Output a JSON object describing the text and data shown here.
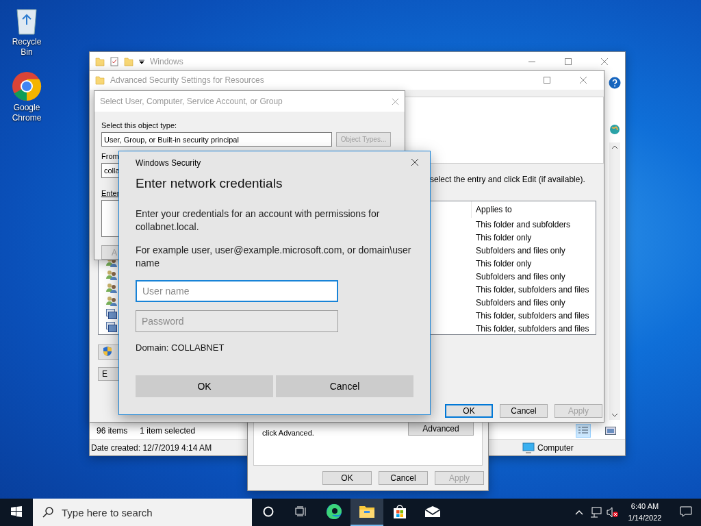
{
  "desktop_icons": [
    {
      "kind": "recycle",
      "label": "Recycle Bin"
    },
    {
      "kind": "chrome",
      "label": "Google Chrome"
    }
  ],
  "explorer": {
    "title": "Windows",
    "status_count": "96 items",
    "status_selected": "1 item selected",
    "date_created": "Date created: 12/7/2019 4:14 AM",
    "location": "Computer",
    "views": [
      {
        "kind": "details",
        "selected": true
      },
      {
        "kind": "thumbnails",
        "selected": false
      }
    ]
  },
  "properties_dialog": {
    "note": "click Advanced.",
    "advanced_button": "Advanced",
    "buttons": [
      {
        "label": "OK",
        "disabled": false
      },
      {
        "label": "Cancel",
        "disabled": false
      },
      {
        "label": "Apply",
        "disabled": true
      }
    ]
  },
  "advanced_security": {
    "title": "Advanced Security Settings for Resources",
    "instruction": "select the entry and click Edit (if available).",
    "table": {
      "columns": [
        "Applies to"
      ],
      "rows": [
        {
          "applies_to": "This folder and subfolders"
        },
        {
          "applies_to": "This folder only"
        },
        {
          "applies_to": "Subfolders and files only"
        },
        {
          "kind": "group",
          "applies_to": "This folder only"
        },
        {
          "kind": "group",
          "applies_to": "Subfolders and files only"
        },
        {
          "kind": "group",
          "applies_to": "This folder, subfolders and files"
        },
        {
          "kind": "group",
          "applies_to": "Subfolders and files only"
        },
        {
          "kind": "computer",
          "applies_to": "This folder, subfolders and files"
        },
        {
          "kind": "computer",
          "applies_to": "This folder, subfolders and files"
        }
      ]
    },
    "edit_button": "E",
    "buttons": [
      {
        "label": "OK",
        "disabled": false,
        "default": true
      },
      {
        "label": "Cancel",
        "disabled": false,
        "default": false
      },
      {
        "label": "Apply",
        "disabled": true,
        "default": false
      }
    ]
  },
  "select_dialog": {
    "title": "Select User, Computer, Service Account, or Group",
    "object_type_label": "Select this object type:",
    "object_type_value": "User, Group, or Built-in security principal",
    "object_types_button": {
      "label": "Object Types...",
      "disabled": true
    },
    "from_label": "From",
    "from_value": "colla",
    "enter_label": "Enter",
    "add_button": "A"
  },
  "security_dialog": {
    "caption": "Windows Security",
    "heading": "Enter network credentials",
    "message": "Enter your credentials for an account with permissions for collabnet.local.",
    "example": "For example user, user@example.microsoft.com, or domain\\user name",
    "username": {
      "placeholder": "User name",
      "focused": true
    },
    "password": {
      "placeholder": "Password",
      "focused": false
    },
    "domain": "Domain: COLLABNET",
    "buttons": [
      "OK",
      "Cancel"
    ]
  },
  "taskbar": {
    "search_placeholder": "Type here to search",
    "apps": [
      {
        "kind": "cortana",
        "selected": false
      },
      {
        "kind": "taskview",
        "selected": false
      },
      {
        "kind": "edge",
        "selected": false
      },
      {
        "kind": "explorer",
        "selected": true
      },
      {
        "kind": "store",
        "selected": false
      },
      {
        "kind": "mail",
        "selected": false
      }
    ],
    "time": "6:40 AM",
    "date": "1/14/2022"
  }
}
